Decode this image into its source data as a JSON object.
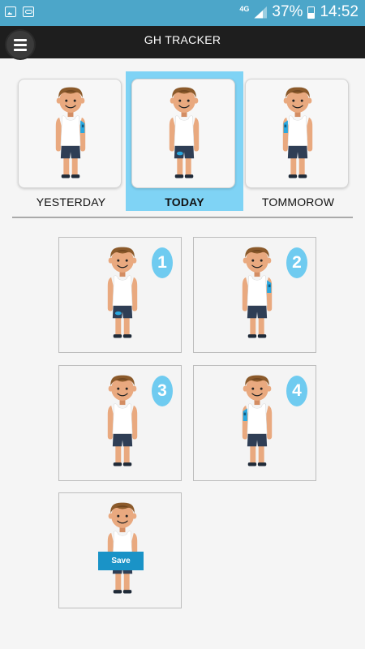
{
  "status_bar": {
    "left_icons": [
      "image-notification-icon",
      "voicemail-icon"
    ],
    "network": "4G",
    "battery_percent": "37%",
    "battery_level": 0.37,
    "time": "14:52"
  },
  "app_bar": {
    "title": "GH TRACKER",
    "menu_icon": "hamburger-menu-icon"
  },
  "days": [
    {
      "label": "YESTERDAY",
      "selected": false,
      "patch": "right-arm"
    },
    {
      "label": "TODAY",
      "selected": true,
      "patch": "thigh"
    },
    {
      "label": "TOMMOROW",
      "selected": false,
      "patch": "left-arm"
    }
  ],
  "zones": [
    {
      "number": "1",
      "patch": "thigh"
    },
    {
      "number": "2",
      "patch": "right-arm"
    },
    {
      "number": "3",
      "patch": "none"
    },
    {
      "number": "4",
      "patch": "left-arm"
    }
  ],
  "save": {
    "label": "Save"
  },
  "colors": {
    "status_bar": "#4ca6c9",
    "app_bar": "#1e1e1e",
    "selected_tab": "#7fd3f5",
    "badge": "#6fcbf0",
    "save_button": "#1a93c7",
    "patch": "#29a8e0"
  }
}
